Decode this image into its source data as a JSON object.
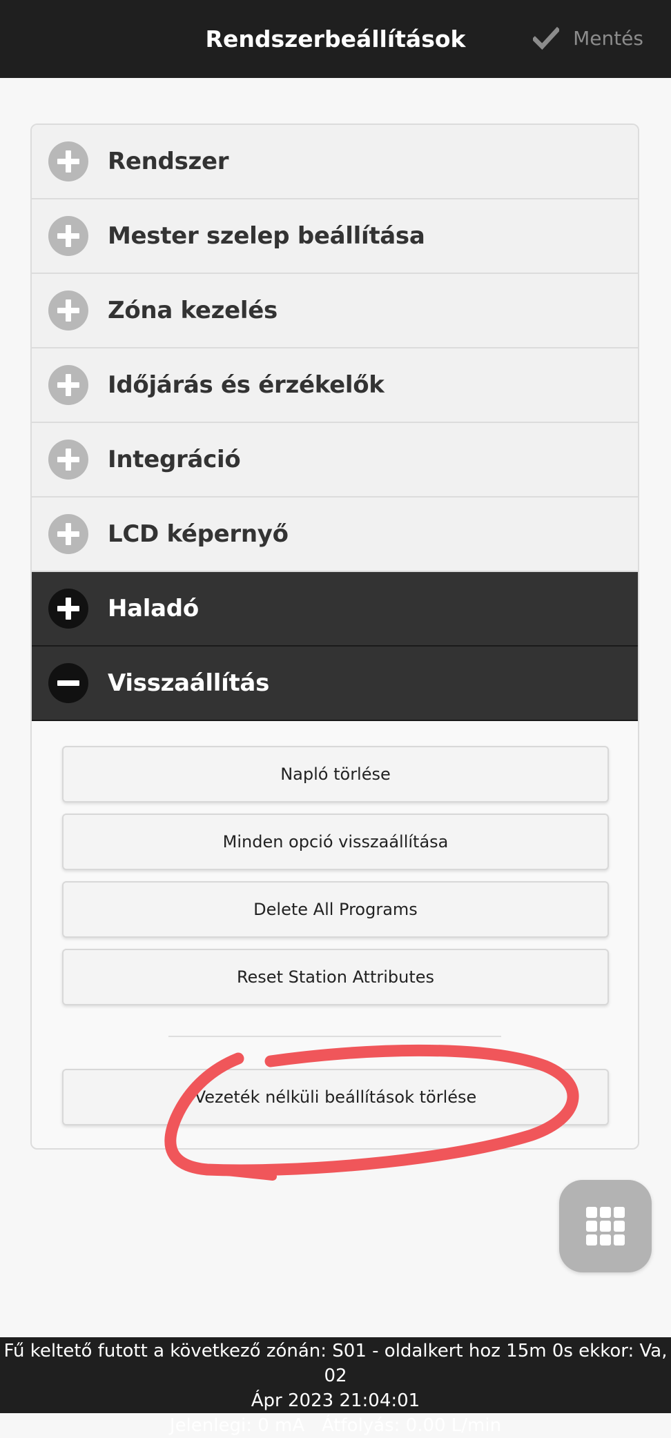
{
  "header": {
    "title": "Rendszerbeállítások",
    "save_label": "Mentés"
  },
  "accordion": {
    "items": [
      {
        "label": "Rendszer",
        "state": "collapsed"
      },
      {
        "label": "Mester szelep beállítása",
        "state": "collapsed"
      },
      {
        "label": "Zóna kezelés",
        "state": "collapsed"
      },
      {
        "label": "Időjárás és érzékelők",
        "state": "collapsed"
      },
      {
        "label": "Integráció",
        "state": "collapsed"
      },
      {
        "label": "LCD képernyő",
        "state": "collapsed"
      },
      {
        "label": "Haladó",
        "state": "collapsed"
      },
      {
        "label": "Visszaállítás",
        "state": "expanded"
      }
    ]
  },
  "reset": {
    "buttons": [
      {
        "label": "Napló törlése"
      },
      {
        "label": "Minden opció visszaállítása"
      },
      {
        "label": "Delete All Programs"
      },
      {
        "label": "Reset Station Attributes"
      }
    ],
    "wireless_button": "Vezeték nélküli beállítások törlése"
  },
  "footer": {
    "line1": "Fű keltető futott a következő zónán: S01 - oldalkert hoz 15m 0s ekkor: Va, 02",
    "line2": "Ápr 2023 21:04:01",
    "line3": "Jelenlegi: 0 mA   Átfolyás: 0.00 L/min"
  },
  "colors": {
    "header_bg": "#1f1f1f",
    "active_section_bg": "#333333",
    "annotation": "#f0565a",
    "fab_bg": "#b3b3b3"
  }
}
